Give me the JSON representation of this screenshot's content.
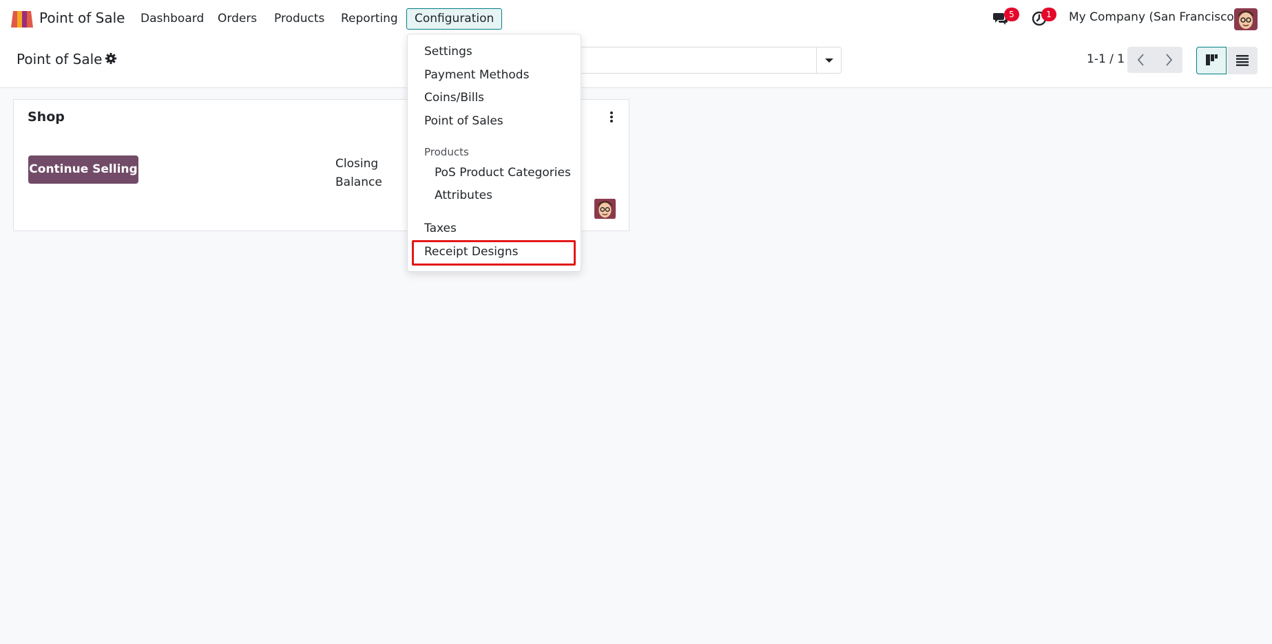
{
  "navbar": {
    "app_name": "Point of Sale",
    "menus": [
      "Dashboard",
      "Orders",
      "Products",
      "Reporting",
      "Configuration"
    ],
    "messages_count": "5",
    "activities_count": "1",
    "company": "My Company (San Francisco)"
  },
  "control_panel": {
    "breadcrumb": "Point of Sale",
    "pager": "1-1 / 1"
  },
  "card": {
    "title": "Shop",
    "continue_label": "Continue Selling",
    "closing_line1": "Closing",
    "closing_line2": "Balance"
  },
  "dropdown": {
    "items": [
      "Settings",
      "Payment Methods",
      "Coins/Bills",
      "Point of Sales"
    ],
    "products_header": "Products",
    "products_items": [
      "PoS Product Categories",
      "Attributes"
    ],
    "taxes": "Taxes",
    "receipt_designs": "Receipt Designs"
  },
  "colors": {
    "brand": "#714b67",
    "accent": "#017e84",
    "badge": "#e4082b",
    "highlight": "#e31818"
  }
}
